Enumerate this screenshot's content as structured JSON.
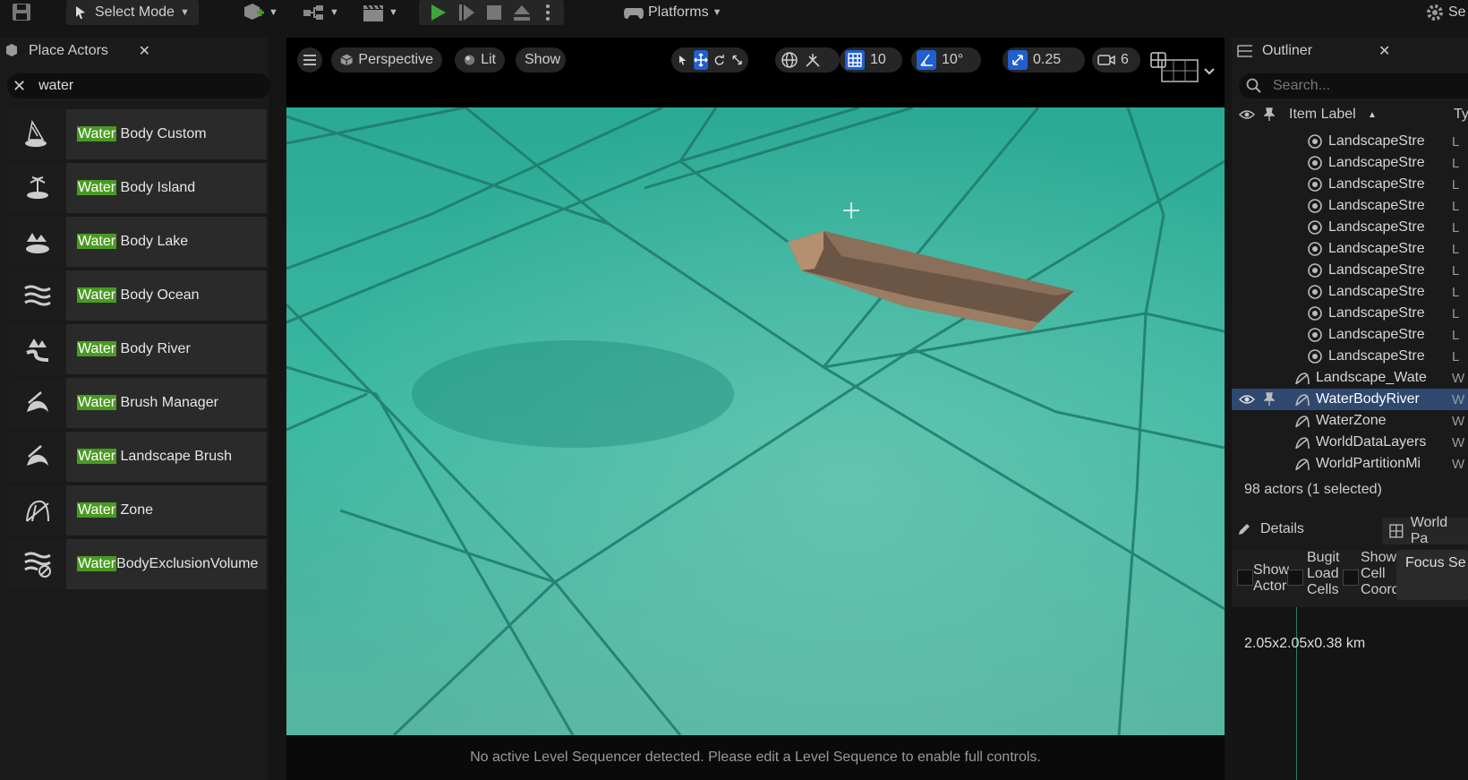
{
  "toolbar": {
    "mode_label": "Select Mode",
    "platforms_label": "Platforms",
    "settings_label": "Se"
  },
  "place_actors": {
    "tab_label": "Place Actors",
    "search_value": "water",
    "items": [
      {
        "highlight": "Water",
        "rest": " Body Custom",
        "icon": "water-body-custom-icon"
      },
      {
        "highlight": "Water",
        "rest": " Body Island",
        "icon": "water-body-island-icon"
      },
      {
        "highlight": "Water",
        "rest": " Body Lake",
        "icon": "water-body-lake-icon"
      },
      {
        "highlight": "Water",
        "rest": " Body Ocean",
        "icon": "water-body-ocean-icon"
      },
      {
        "highlight": "Water",
        "rest": " Body River",
        "icon": "water-body-river-icon"
      },
      {
        "highlight": "Water",
        "rest": " Brush Manager",
        "icon": "water-brush-manager-icon"
      },
      {
        "highlight": "Water",
        "rest": " Landscape Brush",
        "icon": "water-landscape-brush-icon"
      },
      {
        "highlight": "Water",
        "rest": " Zone",
        "icon": "water-zone-icon"
      },
      {
        "highlight": "Water",
        "rest": "BodyExclusionVolume",
        "icon": "water-body-exclusion-volume-icon"
      }
    ]
  },
  "viewport": {
    "perspective_label": "Perspective",
    "lit_label": "Lit",
    "show_label": "Show",
    "grid_snap": "10",
    "rotation_snap": "10°",
    "scale_snap": "0.25",
    "camera_speed": "6",
    "status_message": "No active Level Sequencer detected. Please edit a Level Sequence to enable full controls."
  },
  "outliner": {
    "tab_label": "Outliner",
    "search_placeholder": "Search...",
    "column_label": "Item Label",
    "column_type": "Ty",
    "rows": [
      {
        "label": "LandscapeStre",
        "type": "L"
      },
      {
        "label": "LandscapeStre",
        "type": "L"
      },
      {
        "label": "LandscapeStre",
        "type": "L"
      },
      {
        "label": "LandscapeStre",
        "type": "L"
      },
      {
        "label": "LandscapeStre",
        "type": "L"
      },
      {
        "label": "LandscapeStre",
        "type": "L"
      },
      {
        "label": "LandscapeStre",
        "type": "L"
      },
      {
        "label": "LandscapeStre",
        "type": "L"
      },
      {
        "label": "LandscapeStre",
        "type": "L"
      },
      {
        "label": "LandscapeStre",
        "type": "L"
      },
      {
        "label": "LandscapeStre",
        "type": "L"
      },
      {
        "label": "Landscape_Wate",
        "type": "W"
      },
      {
        "label": "WaterBodyRiver",
        "type": "W",
        "selected": true
      },
      {
        "label": "WaterZone",
        "type": "W"
      },
      {
        "label": "WorldDataLayers",
        "type": "W"
      },
      {
        "label": "WorldPartitionMi",
        "type": "W"
      }
    ],
    "actor_count": "98 actors (1 selected)"
  },
  "details": {
    "tab_label": "Details",
    "world_partition_tab": "World Pa",
    "options": [
      {
        "label": "Show Actor"
      },
      {
        "label": "Bugit Load Cells"
      },
      {
        "label": "Show Cell Coord"
      }
    ],
    "focus_label": "Focus Se",
    "size_label": "2.05x2.05x0.38 km"
  },
  "colors": {
    "accent_blue": "#1f5fd0",
    "highlight_green": "#4a9a22",
    "water": "#3ab7a0",
    "selection": "#2e4870"
  }
}
